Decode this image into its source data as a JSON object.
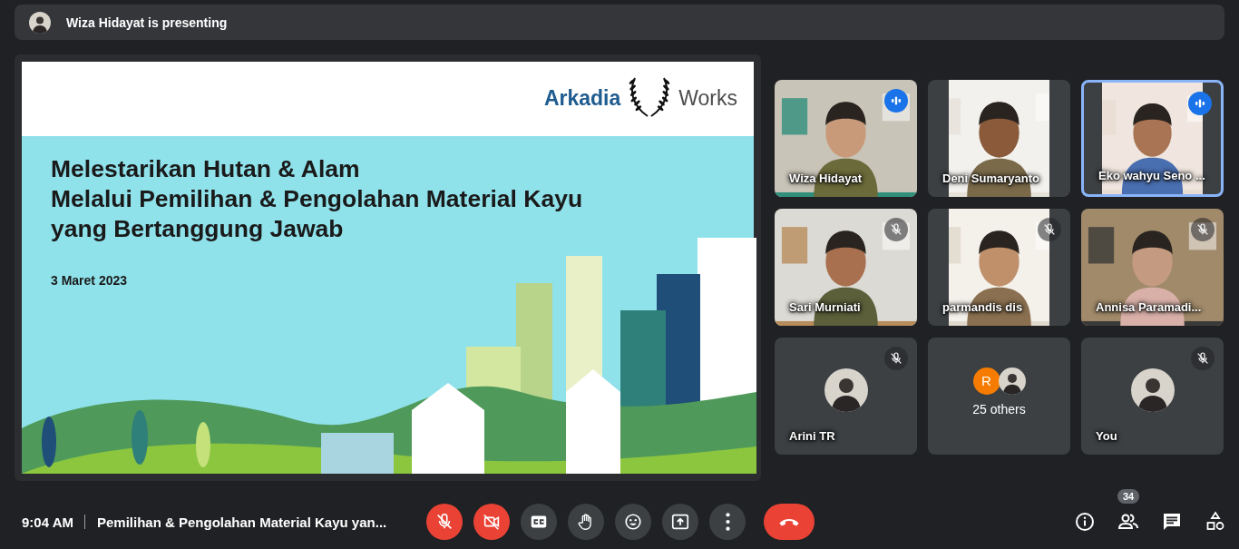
{
  "presenting_banner": {
    "text": "Wiza Hidayat is presenting"
  },
  "slide": {
    "logo": {
      "left": "Arkadia",
      "right": "Works"
    },
    "title_lines": [
      "Melestarikan Hutan & Alam",
      "Melalui Pemilihan & Pengolahan Material Kayu",
      "yang Bertanggung Jawab"
    ],
    "date": "3 Maret 2023"
  },
  "tiles": [
    {
      "kind": "video",
      "name": "Wiza Hidayat",
      "muted": false,
      "speaking": true,
      "highlighted": false
    },
    {
      "kind": "video-portrait",
      "name": "Deni Sumaryanto",
      "muted": false,
      "speaking": false,
      "highlighted": false
    },
    {
      "kind": "video-portrait",
      "name": "Eko wahyu Seno ...",
      "muted": false,
      "speaking": true,
      "highlighted": true
    },
    {
      "kind": "video",
      "name": "Sari Murniati",
      "muted": true,
      "speaking": false,
      "highlighted": false
    },
    {
      "kind": "video-portrait",
      "name": "parmandis dis",
      "muted": true,
      "speaking": false,
      "highlighted": false
    },
    {
      "kind": "video",
      "name": "Annisa Paramadi...",
      "muted": true,
      "speaking": false,
      "highlighted": false
    },
    {
      "kind": "avatar",
      "name": "Arini TR",
      "muted": true,
      "speaking": false,
      "highlighted": false
    },
    {
      "kind": "others",
      "label": "25 others",
      "initial": "R"
    },
    {
      "kind": "avatar",
      "name": "You",
      "muted": true,
      "speaking": false,
      "highlighted": false
    }
  ],
  "bottom_bar": {
    "time": "9:04 AM",
    "meeting_title": "Pemilihan & Pengolahan Material Kayu yan...",
    "controls": [
      {
        "kind": "mic",
        "on": false
      },
      {
        "kind": "camera",
        "on": false
      },
      {
        "kind": "captions",
        "on": false
      },
      {
        "kind": "raise-hand"
      },
      {
        "kind": "reactions"
      },
      {
        "kind": "present"
      },
      {
        "kind": "more"
      },
      {
        "kind": "leave"
      }
    ],
    "panel_buttons": [
      {
        "kind": "info"
      },
      {
        "kind": "people",
        "badge": "34"
      },
      {
        "kind": "chat"
      },
      {
        "kind": "activities"
      }
    ]
  }
}
